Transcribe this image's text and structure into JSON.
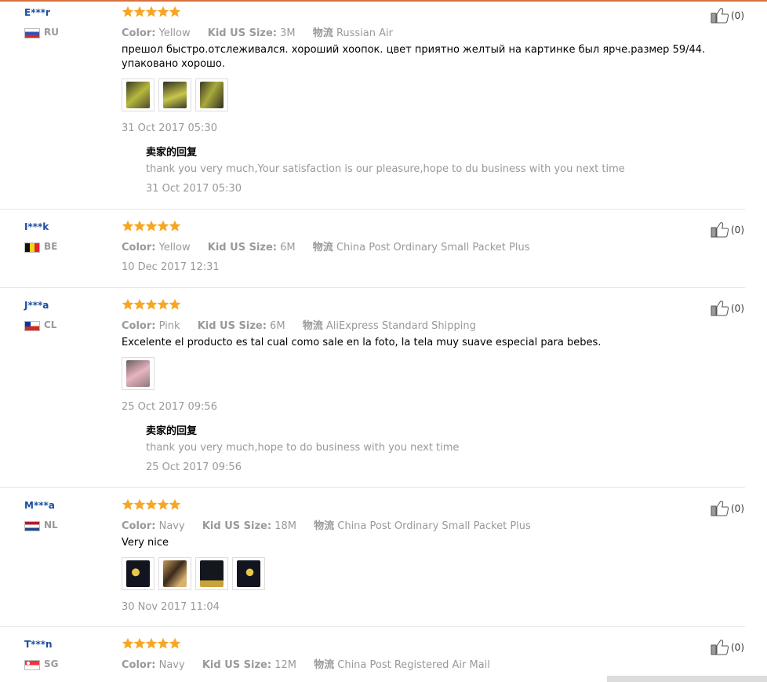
{
  "colors": {
    "accent_line": "#d6713f",
    "username": "#1a4ea0",
    "star": "#f6a623",
    "muted": "#999999"
  },
  "labels": {
    "color": "Color:",
    "size": "Kid US Size:",
    "shipping": "物流",
    "reply_title": "卖家的回复"
  },
  "reviews": [
    {
      "user": "E***r",
      "country": "RU",
      "flag": "ru",
      "color": "Yellow",
      "size": "3M",
      "shipping": "Russian Air",
      "text": "прешол быстро.отслеживался. хороший хоопок. цвет приятно желтый на картинке был ярче.размер 59/44. упаковано хорошо.",
      "photos": [
        "yellow-romper-photo-1",
        "yellow-romper-photo-2",
        "yellow-romper-photo-3"
      ],
      "date": "31 Oct 2017 05:30",
      "reply": {
        "text": "thank you very much,Your satisfaction is our pleasure,hope to du business with you next time",
        "date": "31 Oct 2017 05:30"
      },
      "likes": "(0)",
      "rating": 5
    },
    {
      "user": "I***k",
      "country": "BE",
      "flag": "be",
      "color": "Yellow",
      "size": "6M",
      "shipping": "China Post Ordinary Small Packet Plus",
      "date": "10 Dec 2017 12:31",
      "likes": "(0)",
      "rating": 5
    },
    {
      "user": "J***a",
      "country": "CL",
      "flag": "cl",
      "color": "Pink",
      "size": "6M",
      "shipping": "AliExpress Standard Shipping",
      "text": "Excelente el producto es tal cual como sale en la foto, la tela muy suave especial para bebes.",
      "photos": [
        "pink-romper-photo-1"
      ],
      "date": "25 Oct 2017 09:56",
      "reply": {
        "text": "thank you very much,hope to do business with you next time",
        "date": "25 Oct 2017 09:56"
      },
      "likes": "(0)",
      "rating": 5
    },
    {
      "user": "M***a",
      "country": "NL",
      "flag": "nl",
      "color": "Navy",
      "size": "18M",
      "shipping": "China Post Ordinary Small Packet Plus",
      "text": "Very nice",
      "photos": [
        "navy-romper-photo-1",
        "navy-romper-photo-2",
        "navy-romper-photo-3",
        "navy-romper-photo-4"
      ],
      "date": "30 Nov 2017 11:04",
      "likes": "(0)",
      "rating": 5
    },
    {
      "user": "T***n",
      "country": "SG",
      "flag": "sg",
      "color": "Navy",
      "size": "12M",
      "shipping": "China Post Registered Air Mail",
      "likes": "(0)",
      "rating": 5
    }
  ]
}
